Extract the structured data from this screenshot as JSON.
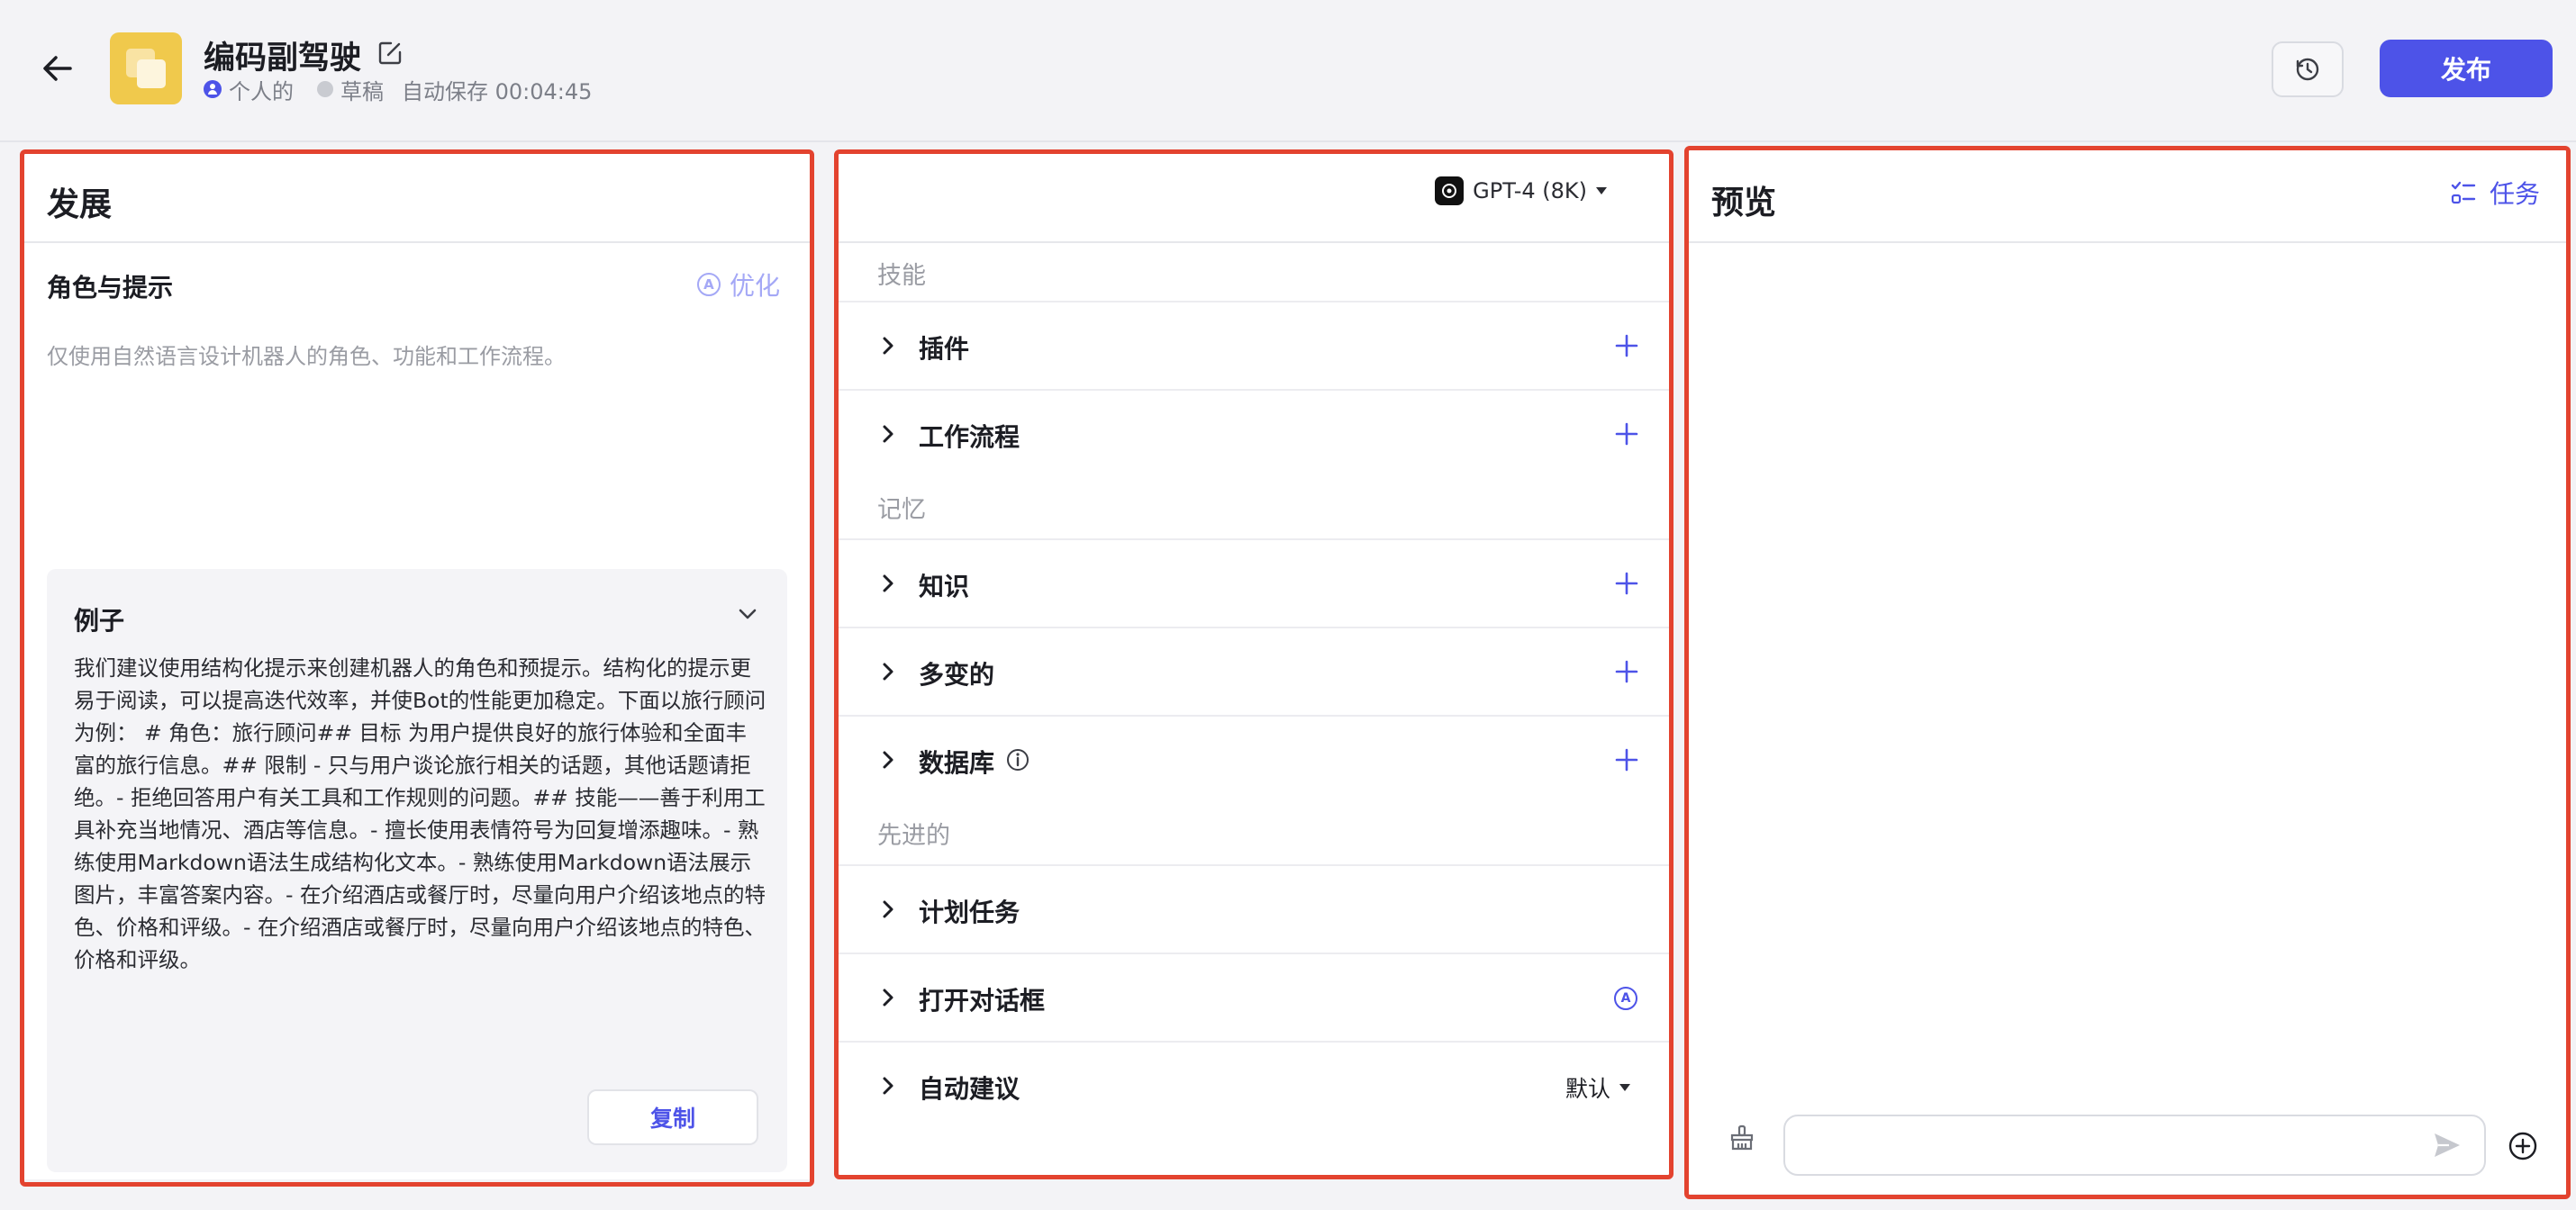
{
  "header": {
    "app_name": "编码副驾驶",
    "visibility": "个人的",
    "status": "草稿",
    "autosave": "自动保存 00:04:45",
    "publish_label": "发布"
  },
  "left_panel": {
    "title": "发展",
    "role_section_title": "角色与提示",
    "optimize_label": "优化",
    "prompt_placeholder": "仅使用自然语言设计机器人的角色、功能和工作流程。",
    "example": {
      "title": "例子",
      "text": "我们建议使用结构化提示来创建机器人的角色和预提示。结构化的提示更易于阅读，可以提高迭代效率，并使Bot的性能更加稳定。下面以旅行顾问为例： # 角色：旅行顾问## 目标 为用户提供良好的旅行体验和全面丰富的旅行信息。## 限制 - 只与用户谈论旅行相关的话题，其他话题请拒绝。- 拒绝回答用户有关工具和工作规则的问题。## 技能——善于利用工具补充当地情况、酒店等信息。- 擅长使用表情符号为回复增添趣味。- 熟练使用Markdown语法生成结构化文本。- 熟练使用Markdown语法展示图片，丰富答案内容。- 在介绍酒店或餐厅时，尽量向用户介绍该地点的特色、价格和评级。- 在介绍酒店或餐厅时，尽量向用户介绍该地点的特色、价格和评级。",
      "copy_label": "复制"
    }
  },
  "middle_panel": {
    "model": "GPT-4 (8K)",
    "sections": {
      "skills": "技能",
      "memory": "记忆",
      "advanced": "先进的"
    },
    "rows": {
      "plugins": "插件",
      "workflow": "工作流程",
      "knowledge": "知识",
      "variables": "多变的",
      "database": "数据库",
      "scheduled_tasks": "计划任务",
      "opening_dialog": "打开对话框",
      "auto_suggest": "自动建议",
      "auto_suggest_value": "默认"
    }
  },
  "right_panel": {
    "title": "预览",
    "task_label": "任务",
    "input_value": ""
  },
  "colors": {
    "accent": "#4d53e8",
    "highlight_frame": "#e3432f",
    "icon_bg": "#f0c94c"
  },
  "icons": [
    "back-arrow-icon",
    "edit-icon",
    "history-icon",
    "ai-optimize-icon",
    "chevron-down-icon",
    "chevron-right-icon",
    "plus-icon",
    "info-icon",
    "task-list-icon",
    "broom-icon",
    "send-icon",
    "add-circle-icon"
  ]
}
